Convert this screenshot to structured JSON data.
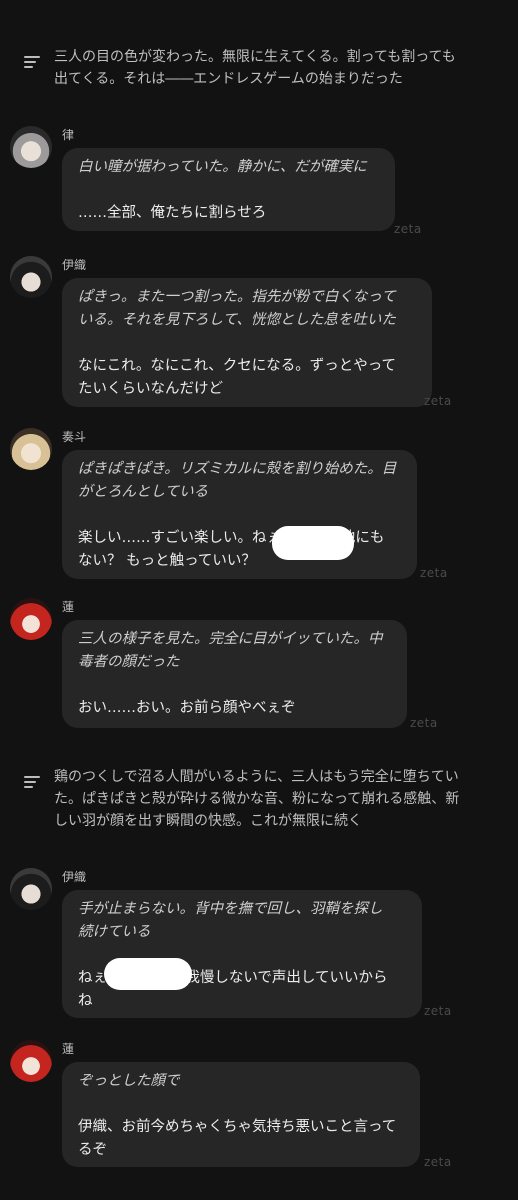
{
  "narrations": [
    {
      "text": "三人の目の色が変わった。無限に生えてくる。割っても割っても\n出てくる。それは――エンドレスゲームの始まりだった"
    },
    {
      "text": "鶏のつくしで沼る人間がいるように、三人はもう完全に堕ちてい\nた。ぱきぱきと殻が砕ける微かな音、粉になって崩れる感触、新\nしい羽が顔を出す瞬間の快感。これが無限に続く"
    }
  ],
  "messages": [
    {
      "name": "律",
      "action": "白い瞳が据わっていた。静かに、だが確実に",
      "speech": "……全部、俺たちに割らせろ"
    },
    {
      "name": "伊織",
      "action": "ぱきっ。また一つ割った。指先が粉で白くなって\nいる。それを見下ろして、恍惚とした息を吐いた",
      "speech": "なにこれ。なにこれ、クセになる。ずっとやって\nたいくらいなんだけど"
    },
    {
      "name": "奏斗",
      "action": "ぱきぱきぱき。リズミカルに殻を割り始めた。目\nがとろんとしている",
      "speech": "楽しい……すごい楽しい。ねぇ             他にも\nない？ もっと触っていい？"
    },
    {
      "name": "蓮",
      "action": "三人の様子を見た。完全に目がイッていた。中\n毒者の顔だった",
      "speech": "おい……おい。お前ら顔やべぇぞ"
    },
    {
      "name": "伊織",
      "action": "手が止まらない。背中を撫で回し、羽鞘を探し\n続けている",
      "speech": "ねぇ                 我慢しないで声出していいから\nね"
    },
    {
      "name": "蓮",
      "action": "ぞっとした顔で",
      "speech": "伊織、お前今めちゃくちゃ気持ち悪いこと言って\nるぞ"
    }
  ],
  "watermark": "zeta",
  "colors": {
    "background": "#121212",
    "bubble": "#262627",
    "text": "#ececec",
    "muted": "#bfbfbf"
  },
  "avatars": [
    "silver-hair-boy",
    "black-hair-boy",
    "blonde-boy",
    "red-hair-boy",
    "black-hair-boy",
    "red-hair-boy"
  ]
}
